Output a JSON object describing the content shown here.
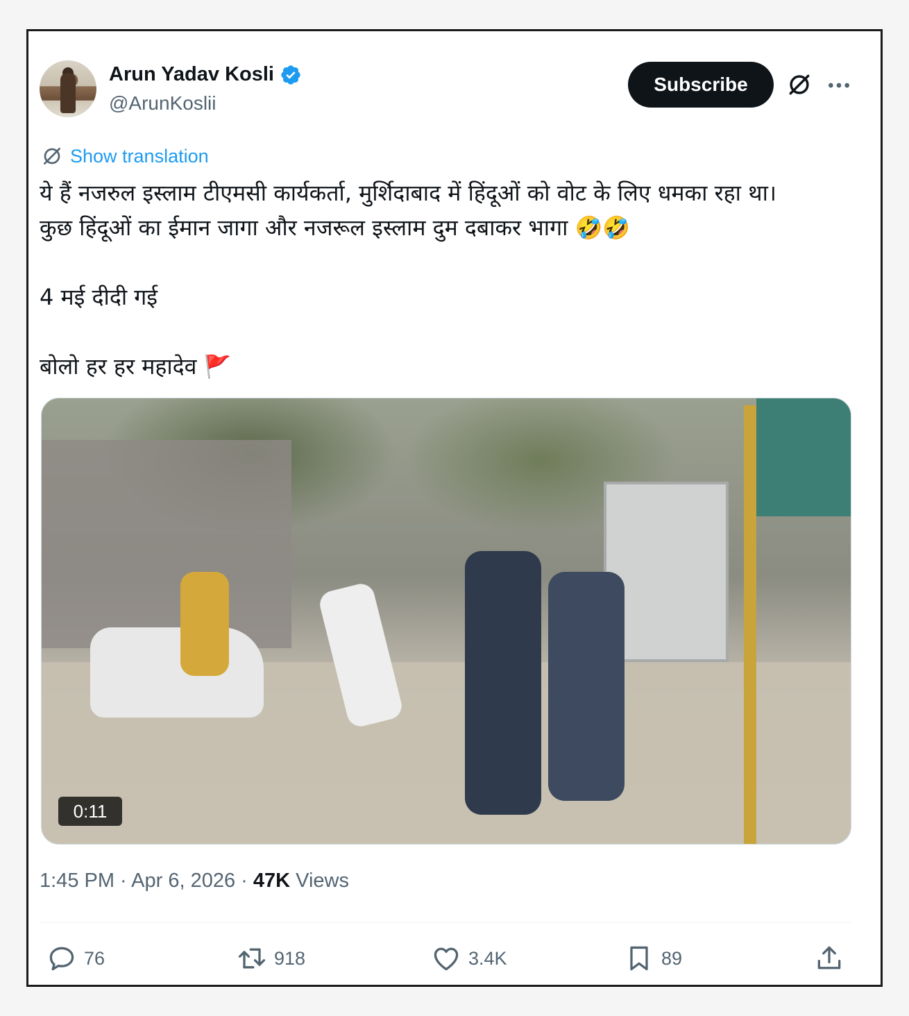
{
  "author": {
    "display_name": "Arun Yadav Kosli",
    "handle": "@ArunKoslii",
    "verified": true
  },
  "header": {
    "subscribe_label": "Subscribe",
    "grok_icon": "grok-icon",
    "more_icon": "more-icon"
  },
  "translation": {
    "label": "Show translation"
  },
  "tweet": {
    "line1": "ये हैं नजरुल इस्लाम टीएमसी कार्यकर्ता, मुर्शिदाबाद में हिंदूओं को वोट के लिए धमका रहा था।",
    "line2": "कुछ हिंदूओं का ईमान जागा और नजरूल इस्लाम दुम दबाकर भागा 🤣🤣",
    "line3": "4 मई दीदी गई",
    "line4": "बोलो हर हर महादेव 🚩"
  },
  "media": {
    "duration": "0:11"
  },
  "meta": {
    "time": "1:45 PM",
    "separator": " · ",
    "date": "Apr 6, 2026",
    "views_count": "47K",
    "views_label": " Views"
  },
  "actions": {
    "replies": "76",
    "retweets": "918",
    "likes": "3.4K",
    "bookmarks": "89"
  },
  "colors": {
    "accent": "#1d9bf0",
    "text": "#0f1419",
    "muted": "#536471",
    "button_bg": "#0f1419"
  }
}
